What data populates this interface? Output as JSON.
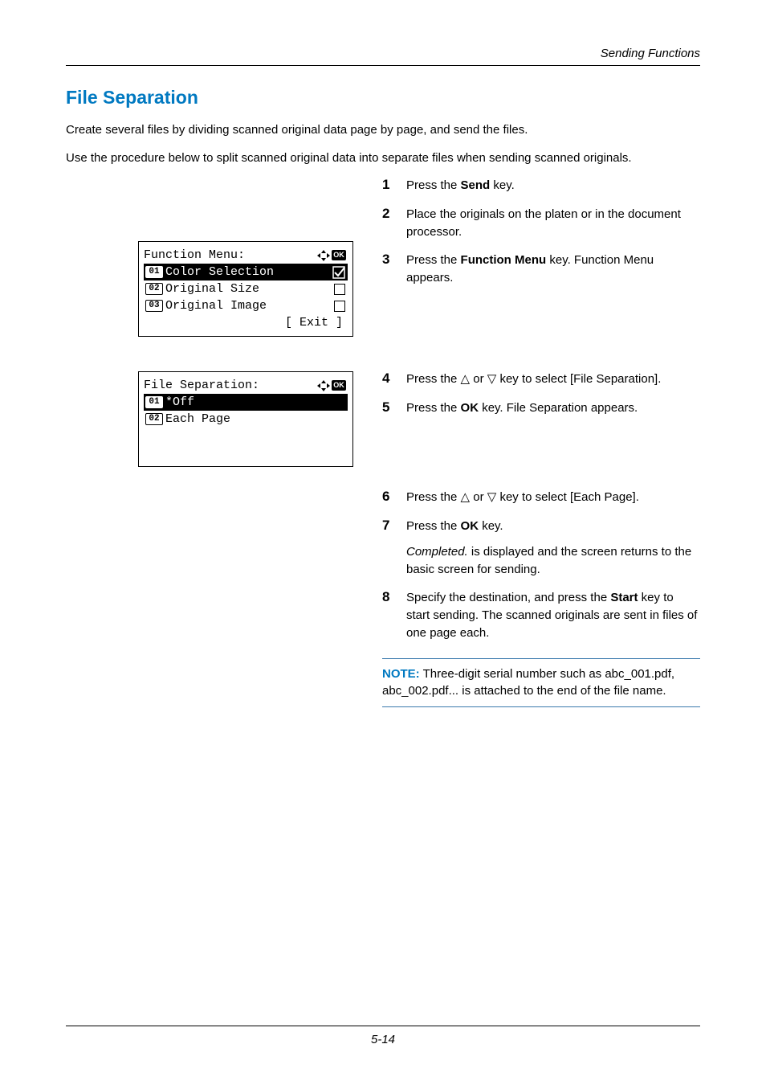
{
  "runningHeader": "Sending Functions",
  "sectionTitle": "File Separation",
  "intro1": "Create several files by dividing scanned original data page by page, and send the files.",
  "intro2": "Use the procedure below to split scanned original data into separate files when sending scanned originals.",
  "steps": {
    "s1": {
      "num": "1",
      "pre": "Press the ",
      "bold": "Send",
      "post": " key."
    },
    "s2": {
      "num": "2",
      "text": "Place the originals on the platen or in the document processor."
    },
    "s3": {
      "num": "3",
      "pre": "Press the ",
      "bold": "Function Menu",
      "post": " key. Function Menu appears."
    },
    "s4": {
      "num": "4",
      "text": "Press the △ or ▽ key to select [File Separation]."
    },
    "s5": {
      "num": "5",
      "pre": "Press the ",
      "bold": "OK",
      "post": " key. File Separation appears."
    },
    "s6": {
      "num": "6",
      "text": "Press the △ or ▽ key to select [Each Page]."
    },
    "s7": {
      "num": "7",
      "pre": "Press the ",
      "bold": "OK",
      "post": " key.",
      "sub_ital": "Completed.",
      "sub_rest": " is displayed and the screen returns to the basic screen for sending."
    },
    "s8": {
      "num": "8",
      "pre": "Specify the destination, and press the ",
      "bold": "Start",
      "post": " key to start sending. The scanned originals are sent in files of one page each."
    }
  },
  "note": {
    "label": "NOTE:",
    "text": " Three-digit serial number such as abc_001.pdf, abc_002.pdf... is attached to the end of the file name."
  },
  "lcd1": {
    "title": "Function Menu:",
    "r1num": "01",
    "r1": " Color Selection",
    "r2num": "02",
    "r2": " Original Size",
    "r3num": "03",
    "r3": " Original Image",
    "exit": "[  Exit  ]"
  },
  "lcd2": {
    "title": "File Separation:",
    "r1num": "01",
    "r1": "*Off",
    "r2num": "02",
    "r2": " Each Page"
  },
  "ok": "OK",
  "pageNum": "5-14"
}
